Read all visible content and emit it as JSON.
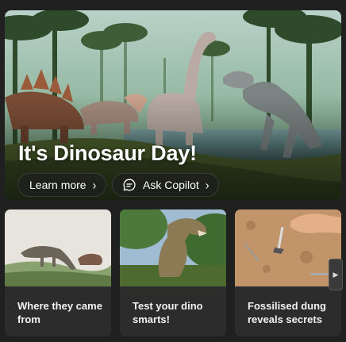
{
  "hero": {
    "title": "It's Dinosaur Day!",
    "learn_label": "Learn more",
    "copilot_label": "Ask Copilot"
  },
  "cards": [
    {
      "caption": "Where they came from"
    },
    {
      "caption": "Test your dino smarts!"
    },
    {
      "caption": "Fossilised dung reveals secrets"
    }
  ],
  "icons": {
    "chevron": "›",
    "next": "▶"
  }
}
